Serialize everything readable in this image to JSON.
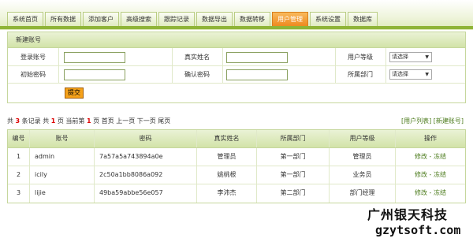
{
  "nav": {
    "tabs": [
      "系统首页",
      "所有数据",
      "添加客户",
      "高级搜索",
      "跟踪记录",
      "数据导出",
      "数据转移",
      "用户管理",
      "系统设置",
      "数据库"
    ],
    "active_index": 7
  },
  "form": {
    "title": "新建账号",
    "login_label": "登录账号",
    "realname_label": "真实姓名",
    "level_label": "用户等级",
    "level_select": "请选择",
    "pwd_label": "初始密码",
    "confirm_label": "确认密码",
    "dept_label": "所属部门",
    "dept_select": "请选择",
    "submit_label": "提交"
  },
  "pager": {
    "prefix": "共",
    "total": "3",
    "records": "条记录 共",
    "pages": "1",
    "page_word": "页 当前第",
    "current": "1",
    "rest": "页 首页 上一页 下一页 尾页"
  },
  "links": {
    "user_list": "[用户列表]",
    "new_account": "[新建账号]"
  },
  "table": {
    "headers": [
      "编号",
      "账号",
      "密码",
      "真实姓名",
      "所属部门",
      "用户等级",
      "操作"
    ],
    "rows": [
      {
        "id": "1",
        "account": "admin",
        "password": "7a57a5a743894a0e",
        "name": "管理员",
        "dept": "第一部门",
        "level": "管理员",
        "edit": "修改",
        "sep": " - ",
        "freeze": "冻结"
      },
      {
        "id": "2",
        "account": "icily",
        "password": "2c50a1bb8086a092",
        "name": "姚桃根",
        "dept": "第一部门",
        "level": "业务员",
        "edit": "修改",
        "sep": " - ",
        "freeze": "冻结"
      },
      {
        "id": "3",
        "account": "lijie",
        "password": "49ba59abbe56e057",
        "name": "李沛杰",
        "dept": "第二部门",
        "level": "部门经理",
        "edit": "修改",
        "sep": " - ",
        "freeze": "冻结"
      }
    ]
  },
  "watermark": {
    "line1": "广州银天科技",
    "line2": "gzytsoft.com"
  }
}
